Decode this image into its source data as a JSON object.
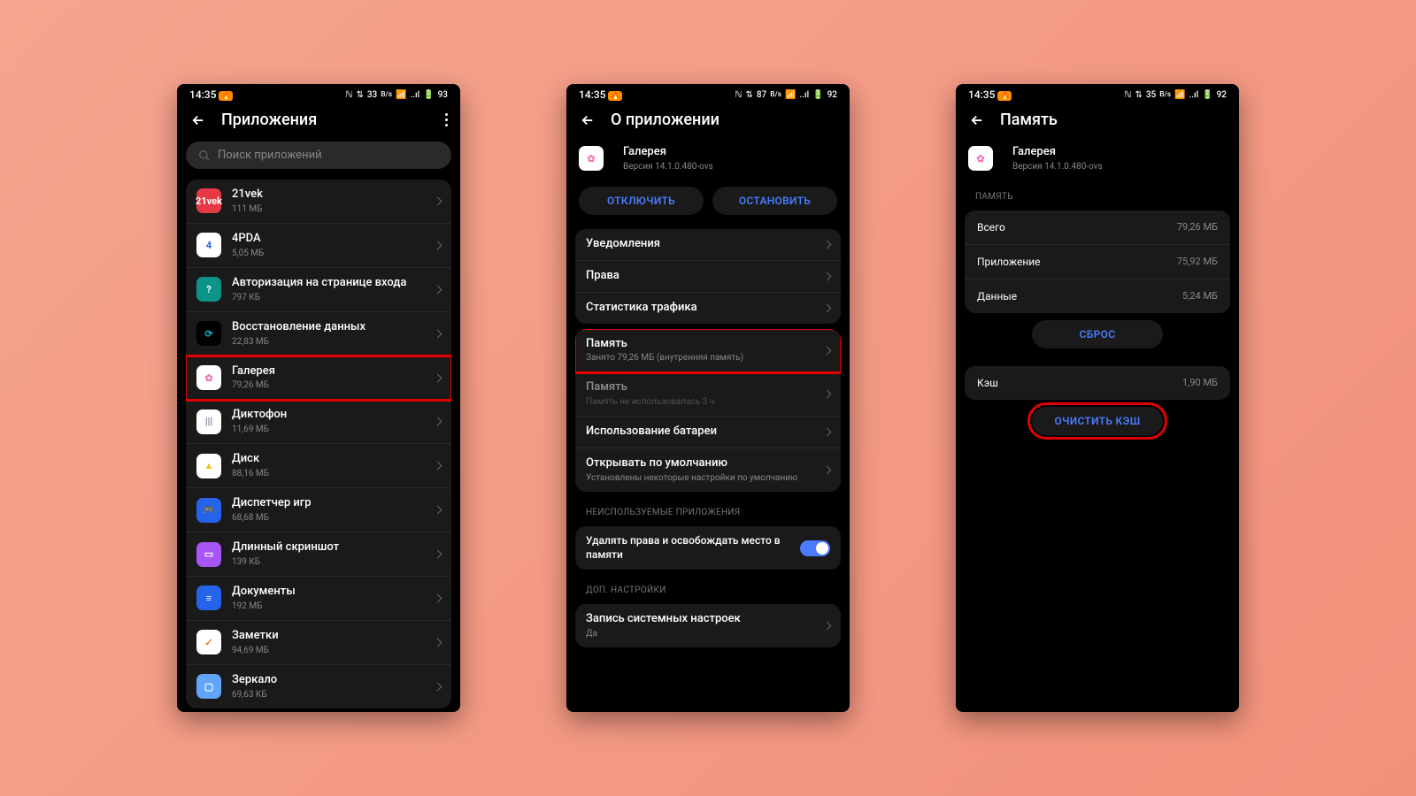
{
  "status": {
    "time": "14:35",
    "net": "33",
    "unit": "B/s",
    "bat1": "93",
    "bat2": "92",
    "bat3": "92",
    "net2": "87",
    "net3": "35"
  },
  "s1": {
    "title": "Приложения",
    "search": "Поиск приложений",
    "apps": [
      {
        "name": "21vek",
        "size": "111 МБ",
        "bg": "#e63946",
        "txt": "21vek",
        "tc": "#fff"
      },
      {
        "name": "4PDA",
        "size": "5,05 МБ",
        "bg": "#fff",
        "txt": "4",
        "tc": "#2563eb"
      },
      {
        "name": "Авторизация на странице входа",
        "size": "797 КБ",
        "bg": "#0d9488",
        "txt": "?",
        "tc": "#fff"
      },
      {
        "name": "Восстановление данных",
        "size": "22,83 МБ",
        "bg": "#000",
        "txt": "⟳",
        "tc": "#06b6d4"
      },
      {
        "name": "Галерея",
        "size": "79,26 МБ",
        "bg": "#fff",
        "txt": "✿",
        "tc": "#f472b6",
        "hl": true
      },
      {
        "name": "Диктофон",
        "size": "11,69 МБ",
        "bg": "#fff",
        "txt": "|||",
        "tc": "#64748b"
      },
      {
        "name": "Диск",
        "size": "88,16 МБ",
        "bg": "#fff",
        "txt": "▲",
        "tc": "#fbbf24"
      },
      {
        "name": "Диспетчер игр",
        "size": "68,68 МБ",
        "bg": "#2563eb",
        "txt": "🎮",
        "tc": "#fff"
      },
      {
        "name": "Длинный скриншот",
        "size": "139 КБ",
        "bg": "#a855f7",
        "txt": "▭",
        "tc": "#fff"
      },
      {
        "name": "Документы",
        "size": "192 МБ",
        "bg": "#2563eb",
        "txt": "≡",
        "tc": "#fff"
      },
      {
        "name": "Заметки",
        "size": "94,69 МБ",
        "bg": "#fff",
        "txt": "✓",
        "tc": "#f97316"
      },
      {
        "name": "Зеркало",
        "size": "69,63 КБ",
        "bg": "#60a5fa",
        "txt": "▢",
        "tc": "#fff"
      }
    ]
  },
  "s2": {
    "title": "О приложении",
    "app": {
      "name": "Галерея",
      "version": "Версия 14.1.0.480-ovs"
    },
    "btn1": "ОТКЛЮЧИТЬ",
    "btn2": "ОСТАНОВИТЬ",
    "rows1": [
      {
        "t": "Уведомления"
      },
      {
        "t": "Права"
      },
      {
        "t": "Статистика трафика"
      }
    ],
    "rows2": [
      {
        "t": "Память",
        "s": "Занято 79,26 МБ (внутренняя память)",
        "hl": true
      },
      {
        "t": "Память",
        "s": "Память не использовалась 3 ч",
        "dim": true
      },
      {
        "t": "Использование батареи"
      },
      {
        "t": "Открывать по умолчанию",
        "s": "Установлены некоторые настройки по умолчанию"
      }
    ],
    "sec1": "НЕИСПОЛЬЗУЕМЫЕ ПРИЛОЖЕНИЯ",
    "toggle": "Удалять права и освобождать место в памяти",
    "sec2": "ДОП. НАСТРОЙКИ",
    "rows3": [
      {
        "t": "Запись системных настроек",
        "s": "Да"
      }
    ]
  },
  "s3": {
    "title": "Память",
    "app": {
      "name": "Галерея",
      "version": "Версия 14.1.0.480-ovs"
    },
    "sec": "ПАМЯТЬ",
    "kv": [
      {
        "k": "Всего",
        "v": "79,26 МБ"
      },
      {
        "k": "Приложение",
        "v": "75,92 МБ"
      },
      {
        "k": "Данные",
        "v": "5,24 МБ"
      }
    ],
    "btn1": "СБРОС",
    "cache": {
      "k": "Кэш",
      "v": "1,90 МБ"
    },
    "btn2": "ОЧИСТИТЬ КЭШ"
  }
}
